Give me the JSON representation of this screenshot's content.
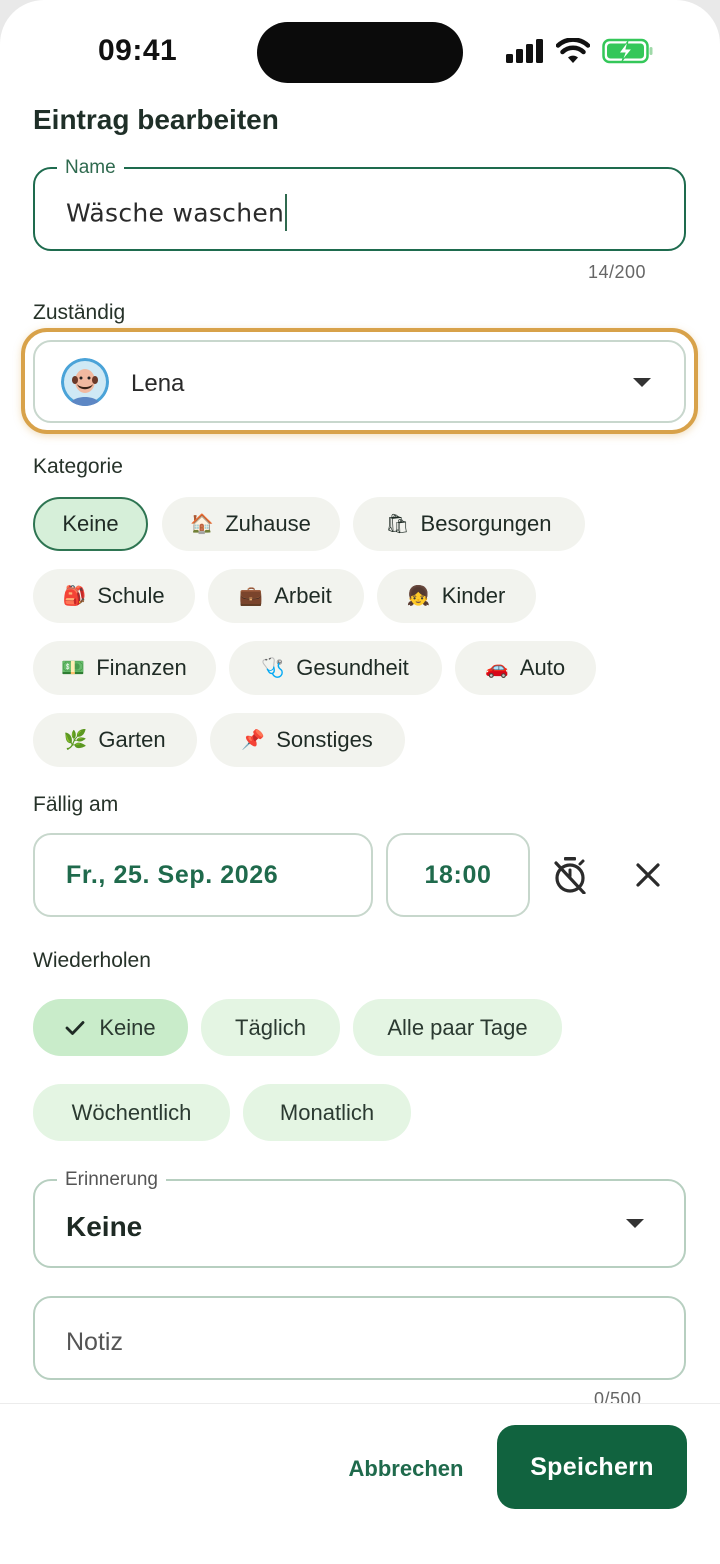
{
  "status_bar": {
    "time": "09:41"
  },
  "header": {
    "title": "Eintrag bearbeiten"
  },
  "name_field": {
    "label": "Name",
    "value": "Wäsche waschen",
    "counter": "14/200"
  },
  "assignee": {
    "label": "Zuständig",
    "name": "Lena"
  },
  "category": {
    "label": "Kategorie",
    "items": [
      {
        "label": "Keine",
        "icon": "none",
        "selected": true
      },
      {
        "label": "Zuhause",
        "icon": "house-icon"
      },
      {
        "label": "Besorgungen",
        "icon": "shopping-bags-icon"
      },
      {
        "label": "Schule",
        "icon": "backpack-icon"
      },
      {
        "label": "Arbeit",
        "icon": "briefcase-icon"
      },
      {
        "label": "Kinder",
        "icon": "child-icon"
      },
      {
        "label": "Finanzen",
        "icon": "banknote-icon"
      },
      {
        "label": "Gesundheit",
        "icon": "stethoscope-icon"
      },
      {
        "label": "Auto",
        "icon": "car-icon"
      },
      {
        "label": "Garten",
        "icon": "herb-icon"
      },
      {
        "label": "Sonstiges",
        "icon": "pushpin-icon"
      }
    ]
  },
  "due": {
    "label": "Fällig am",
    "date": "Fr., 25. Sep. 2026",
    "time": "18:00"
  },
  "repeat": {
    "label": "Wiederholen",
    "items": [
      {
        "label": "Keine",
        "selected": true
      },
      {
        "label": "Täglich"
      },
      {
        "label": "Alle paar Tage"
      },
      {
        "label": "Wöchentlich"
      },
      {
        "label": "Monatlich"
      }
    ]
  },
  "reminder": {
    "label": "Erinnerung",
    "value": "Keine"
  },
  "note": {
    "placeholder": "Notiz",
    "counter": "0/500"
  },
  "actions": {
    "cancel": "Abbrechen",
    "save": "Speichern"
  },
  "colors": {
    "primary": "#11633f",
    "accent_focus": "#d8a24a",
    "chip_selected": "#d6efd9",
    "repeat_chip": "#e4f5e3"
  }
}
